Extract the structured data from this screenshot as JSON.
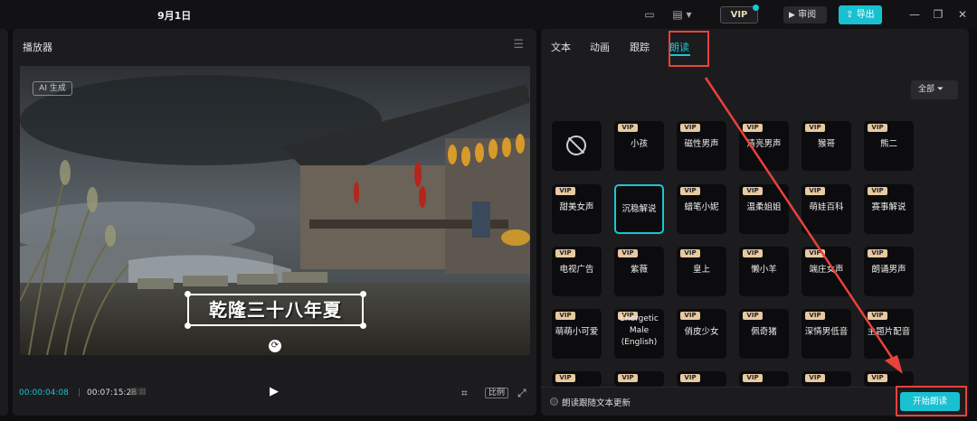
{
  "topbar": {
    "date": "9月1日",
    "vip_label": "VIP",
    "review_label": "审阅",
    "export_label": "导出"
  },
  "player": {
    "title": "播放器",
    "ai_tag": "AI 生成",
    "caption": "乾隆三十八年夏",
    "time_current": "00:00:04:08",
    "time_separator": "|",
    "time_total": "00:07:15:28",
    "ratio_label": "比例"
  },
  "right_panel": {
    "tabs": [
      {
        "label": "文本"
      },
      {
        "label": "动画"
      },
      {
        "label": "跟踪"
      },
      {
        "label": "朗读"
      }
    ],
    "filter_label": "全部",
    "vip_tag": "VIP",
    "voices": [
      {
        "label": "",
        "vip": false,
        "none": true
      },
      {
        "label": "小孩",
        "vip": true
      },
      {
        "label": "磁性男声",
        "vip": true
      },
      {
        "label": "清亮男声",
        "vip": true
      },
      {
        "label": "猴哥",
        "vip": true
      },
      {
        "label": "熊二",
        "vip": true
      },
      {
        "label": "甜美女声",
        "vip": true
      },
      {
        "label": "沉稳解说",
        "vip": false,
        "selected": true
      },
      {
        "label": "蜡笔小妮",
        "vip": true
      },
      {
        "label": "温柔姐姐",
        "vip": true
      },
      {
        "label": "萌娃百科",
        "vip": true
      },
      {
        "label": "赛事解说",
        "vip": true
      },
      {
        "label": "电视广告",
        "vip": true
      },
      {
        "label": "紫薇",
        "vip": true
      },
      {
        "label": "皇上",
        "vip": true
      },
      {
        "label": "懒小羊",
        "vip": true
      },
      {
        "label": "端庄女声",
        "vip": true
      },
      {
        "label": "朗诵男声",
        "vip": true
      },
      {
        "label": "萌萌小可爱",
        "vip": true
      },
      {
        "label": "Energetic Male (English)",
        "vip": true
      },
      {
        "label": "俏皮少女",
        "vip": true
      },
      {
        "label": "佩奇猪",
        "vip": true
      },
      {
        "label": "深情男低音",
        "vip": true
      },
      {
        "label": "主题片配音",
        "vip": true
      }
    ],
    "follow_label": "朗读跟随文本更新",
    "start_label": "开始朗读"
  }
}
